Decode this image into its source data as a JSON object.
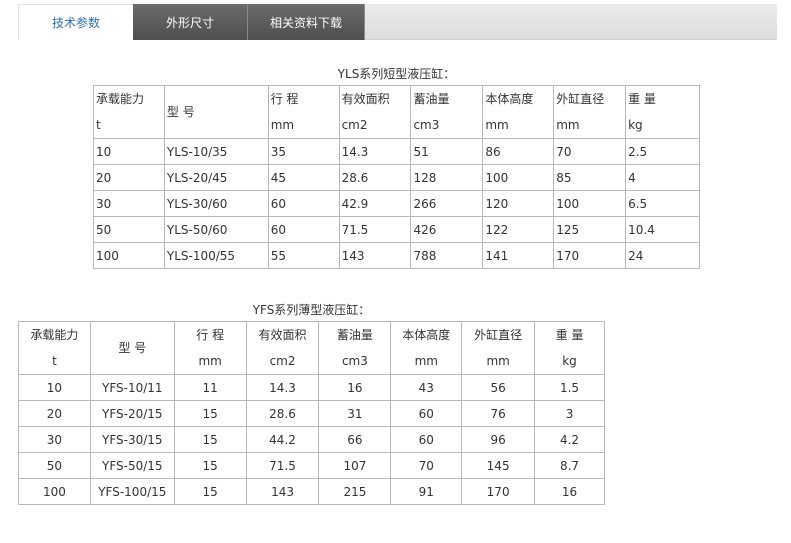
{
  "tabs": [
    {
      "label": "技术参数"
    },
    {
      "label": "外形尺寸"
    },
    {
      "label": "相关资料下载"
    }
  ],
  "yls": {
    "caption": "YLS系列短型液压缸：",
    "headers": [
      {
        "name": "承载能力",
        "unit": "t"
      },
      {
        "name": "型  号",
        "unit": ""
      },
      {
        "name": "行  程",
        "unit": "mm"
      },
      {
        "name": "有效面积",
        "unit": "cm2"
      },
      {
        "name": "蓄油量",
        "unit": "cm3"
      },
      {
        "name": "本体高度",
        "unit": "mm"
      },
      {
        "name": "外缸直径",
        "unit": "mm"
      },
      {
        "name": "重 量",
        "unit": "kg"
      }
    ],
    "rows": [
      [
        "10",
        "YLS-10/35",
        "35",
        "14.3",
        "51",
        "86",
        "70",
        "2.5"
      ],
      [
        "20",
        "YLS-20/45",
        "45",
        "28.6",
        "128",
        "100",
        "85",
        "4"
      ],
      [
        "30",
        "YLS-30/60",
        "60",
        "42.9",
        "266",
        "120",
        "100",
        "6.5"
      ],
      [
        "50",
        "YLS-50/60",
        "60",
        "71.5",
        "426",
        "122",
        "125",
        "10.4"
      ],
      [
        "100",
        "YLS-100/55",
        "55",
        "143",
        "788",
        "141",
        "170",
        "24"
      ]
    ]
  },
  "yfs": {
    "caption": "YFS系列薄型液压缸：",
    "headers": [
      {
        "name": "承载能力",
        "unit": "t"
      },
      {
        "name": "型  号",
        "unit": ""
      },
      {
        "name": "行  程",
        "unit": "mm"
      },
      {
        "name": "有效面积",
        "unit": "cm2"
      },
      {
        "name": "蓄油量",
        "unit": "cm3"
      },
      {
        "name": "本体高度",
        "unit": "mm"
      },
      {
        "name": "外缸直径",
        "unit": "mm"
      },
      {
        "name": "重 量",
        "unit": "kg"
      }
    ],
    "rows": [
      [
        "10",
        "YFS-10/11",
        "11",
        "14.3",
        "16",
        "43",
        "56",
        "1.5"
      ],
      [
        "20",
        "YFS-20/15",
        "15",
        "28.6",
        "31",
        "60",
        "76",
        "3"
      ],
      [
        "30",
        "YFS-30/15",
        "15",
        "44.2",
        "66",
        "60",
        "96",
        "4.2"
      ],
      [
        "50",
        "YFS-50/15",
        "15",
        "71.5",
        "107",
        "70",
        "145",
        "8.7"
      ],
      [
        "100",
        "YFS-100/15",
        "15",
        "143",
        "215",
        "91",
        "170",
        "16"
      ]
    ]
  }
}
